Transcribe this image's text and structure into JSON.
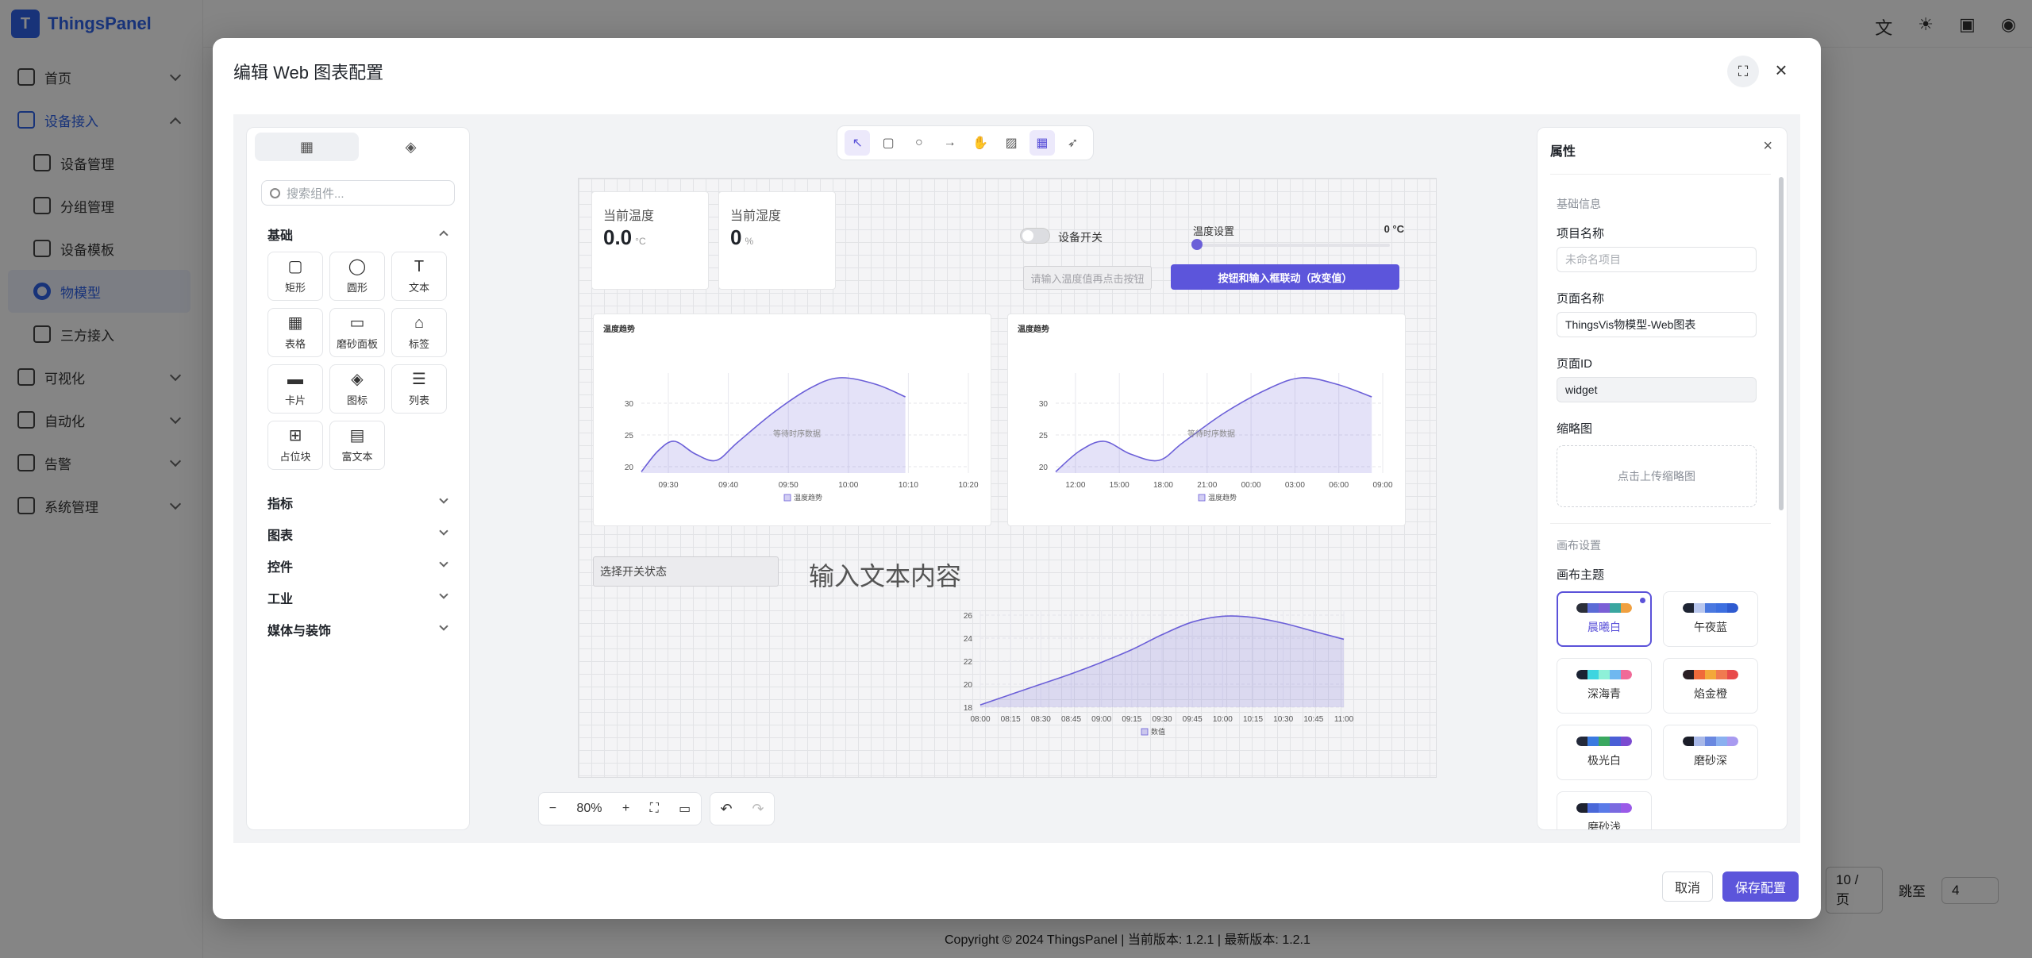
{
  "app": {
    "name": "ThingsPanel",
    "logo_letter": "T"
  },
  "sidebar": {
    "items": [
      {
        "label": "首页",
        "type": "group",
        "icon": "home-icon"
      },
      {
        "label": "设备接入",
        "type": "group-open",
        "icon": "device-access-icon"
      },
      {
        "label": "设备管理",
        "type": "sub",
        "icon": "device-manage-icon"
      },
      {
        "label": "分组管理",
        "type": "sub",
        "icon": "group-manage-icon"
      },
      {
        "label": "设备模板",
        "type": "sub",
        "icon": "device-template-icon"
      },
      {
        "label": "物模型",
        "type": "sub-active",
        "icon": "thing-model-icon"
      },
      {
        "label": "三方接入",
        "type": "sub",
        "icon": "third-party-icon"
      },
      {
        "label": "可视化",
        "type": "group",
        "icon": "visualization-icon"
      },
      {
        "label": "自动化",
        "type": "group",
        "icon": "automation-icon"
      },
      {
        "label": "告警",
        "type": "group",
        "icon": "alarm-icon"
      },
      {
        "label": "系统管理",
        "type": "group",
        "icon": "system-manage-icon"
      }
    ]
  },
  "background": {
    "footer": "Copyright © 2024 ThingsPanel  |  当前版本: 1.2.1  |  最新版本: 1.2.1",
    "pager": {
      "page_size": "10 / 页",
      "jump_label": "跳至",
      "jump_value": "4"
    }
  },
  "modal": {
    "title": "编辑 Web 图表配置",
    "cancel_label": "取消",
    "save_label": "保存配置"
  },
  "left_panel": {
    "search_placeholder": "搜索组件...",
    "sections": [
      "基础",
      "指标",
      "图表",
      "控件",
      "工业",
      "媒体与装饰"
    ],
    "components": [
      {
        "label": "矩形",
        "icon": "rectangle-icon",
        "glyph": "▢"
      },
      {
        "label": "圆形",
        "icon": "circle-icon",
        "glyph": "◯"
      },
      {
        "label": "文本",
        "icon": "text-icon",
        "glyph": "T"
      },
      {
        "label": "表格",
        "icon": "table-icon",
        "glyph": "▦"
      },
      {
        "label": "磨砂面板",
        "icon": "panel-icon",
        "glyph": "▭"
      },
      {
        "label": "标签",
        "icon": "tag-icon",
        "glyph": "⌂"
      },
      {
        "label": "卡片",
        "icon": "card-icon",
        "glyph": "▬"
      },
      {
        "label": "图标",
        "icon": "shapes-icon",
        "glyph": "◈"
      },
      {
        "label": "列表",
        "icon": "list-icon",
        "glyph": "☰"
      },
      {
        "label": "占位块",
        "icon": "placeholder-icon",
        "glyph": "⊞"
      },
      {
        "label": "富文本",
        "icon": "rich-text-icon",
        "glyph": "▤"
      }
    ]
  },
  "toolbar": {
    "tools": [
      {
        "name": "select-tool",
        "glyph": "↖"
      },
      {
        "name": "rectangle-tool",
        "glyph": "▢"
      },
      {
        "name": "circle-tool",
        "glyph": "○"
      },
      {
        "name": "arrow-tool",
        "glyph": "→"
      },
      {
        "name": "hand-tool",
        "glyph": "✋"
      },
      {
        "name": "image-tool",
        "glyph": "▨"
      },
      {
        "name": "grid-tool",
        "glyph": "▦"
      },
      {
        "name": "publish-tool",
        "glyph": "➶"
      }
    ]
  },
  "canvas": {
    "kpi1": {
      "label": "当前温度",
      "value": "0.0",
      "unit": "°C"
    },
    "kpi2": {
      "label": "当前湿度",
      "value": "0",
      "unit": "%"
    },
    "switch_label": "设备开关",
    "slider_title": "温度设置",
    "slider_value": "0 °C",
    "slider_fraction": 0,
    "temp_input_placeholder": "请输入温度值再点击按钮",
    "link_button": "按钮和输入框联动（改变值）",
    "select_label": "选择开关状态",
    "text_content": "输入文本内容",
    "zoom": "80%"
  },
  "chart_data": [
    {
      "type": "area",
      "title": "温度趋势",
      "x": [
        "09:30",
        "09:40",
        "09:50",
        "10:00",
        "10:10",
        "10:20"
      ],
      "y_ticks": [
        20,
        25,
        30
      ],
      "ylim": [
        19,
        34
      ],
      "series": [
        {
          "name": "温度趋势",
          "points": [
            [
              0,
              19.2
            ],
            [
              0.28,
              22.5
            ],
            [
              0.55,
              24
            ],
            [
              0.9,
              22
            ],
            [
              1.25,
              21
            ],
            [
              1.6,
              23.8
            ],
            [
              2.2,
              28.5
            ],
            [
              2.8,
              32.3
            ],
            [
              3.3,
              34
            ],
            [
              3.9,
              33
            ],
            [
              4.4,
              31
            ]
          ]
        }
      ],
      "annotation": "等待时序数据",
      "legend": "bottom"
    },
    {
      "type": "area",
      "title": "温度趋势",
      "x": [
        "12:00",
        "15:00",
        "18:00",
        "21:00",
        "00:00",
        "03:00",
        "06:00",
        "09:00"
      ],
      "y_ticks": [
        20,
        25,
        30
      ],
      "ylim": [
        19,
        34
      ],
      "series": [
        {
          "name": "温度趋势",
          "points": [
            [
              0,
              19.2
            ],
            [
              0.55,
              22.5
            ],
            [
              1.1,
              24
            ],
            [
              1.7,
              22
            ],
            [
              2.35,
              21
            ],
            [
              2.9,
              23.8
            ],
            [
              3.85,
              28.5
            ],
            [
              4.85,
              32.3
            ],
            [
              5.6,
              34
            ],
            [
              6.4,
              33
            ],
            [
              7.2,
              31
            ]
          ]
        }
      ],
      "annotation": "等待时序数据",
      "legend": "bottom"
    },
    {
      "type": "area",
      "title": "",
      "x": [
        "08:00",
        "08:15",
        "08:30",
        "08:45",
        "09:00",
        "09:15",
        "09:30",
        "09:45",
        "10:00",
        "10:15",
        "10:30",
        "10:45",
        "11:00"
      ],
      "y_ticks": [
        18,
        20,
        22,
        24,
        26
      ],
      "ylim": [
        18,
        26
      ],
      "series": [
        {
          "name": "数值",
          "values": [
            18.2,
            19.1,
            20,
            20.9,
            21.9,
            23,
            24.3,
            25.4,
            25.9,
            25.8,
            25.3,
            24.6,
            23.9
          ]
        }
      ],
      "legend": "bottom"
    }
  ],
  "right_panel": {
    "title": "属性",
    "basic_info": "基础信息",
    "project_name_label": "项目名称",
    "project_name_placeholder": "未命名项目",
    "page_name_label": "页面名称",
    "page_name_value": "ThingsVis物模型-Web图表",
    "page_id_label": "页面ID",
    "page_id_value": "widget",
    "thumbnail_label": "缩略图",
    "upload_text": "点击上传缩略图",
    "canvas_settings": "画布设置",
    "canvas_theme": "画布主题",
    "themes": [
      {
        "name": "晨曦白",
        "colors": [
          "#2b2f3a",
          "#5b6bd6",
          "#7a5fd6",
          "#3aa6a0",
          "#f0a040"
        ],
        "selected": true
      },
      {
        "name": "午夜蓝",
        "colors": [
          "#1e2433",
          "#b9c7ee",
          "#4a78e0",
          "#3d6fe0",
          "#2f5bd0"
        ],
        "selected": false
      },
      {
        "name": "深海青",
        "colors": [
          "#1a2233",
          "#3ed5e0",
          "#8ef0d8",
          "#6fb8f0",
          "#f06a98"
        ],
        "selected": false
      },
      {
        "name": "焰金橙",
        "colors": [
          "#2a1f24",
          "#f06a3a",
          "#f3a83a",
          "#f07a50",
          "#e84a4a"
        ],
        "selected": false
      },
      {
        "name": "极光白",
        "colors": [
          "#23293a",
          "#3a7ae0",
          "#3aa860",
          "#4a5fd6",
          "#7a4ad0"
        ],
        "selected": false
      },
      {
        "name": "磨砂深",
        "colors": [
          "#1a1d28",
          "#a8b8e8",
          "#6a88e0",
          "#8ab0f0",
          "#a89af0"
        ],
        "selected": false
      },
      {
        "name": "磨砂浅",
        "colors": [
          "#1e2230",
          "#4a68d8",
          "#5a7ae8",
          "#7a6ae0",
          "#9a5ae8"
        ],
        "selected": false
      }
    ]
  }
}
